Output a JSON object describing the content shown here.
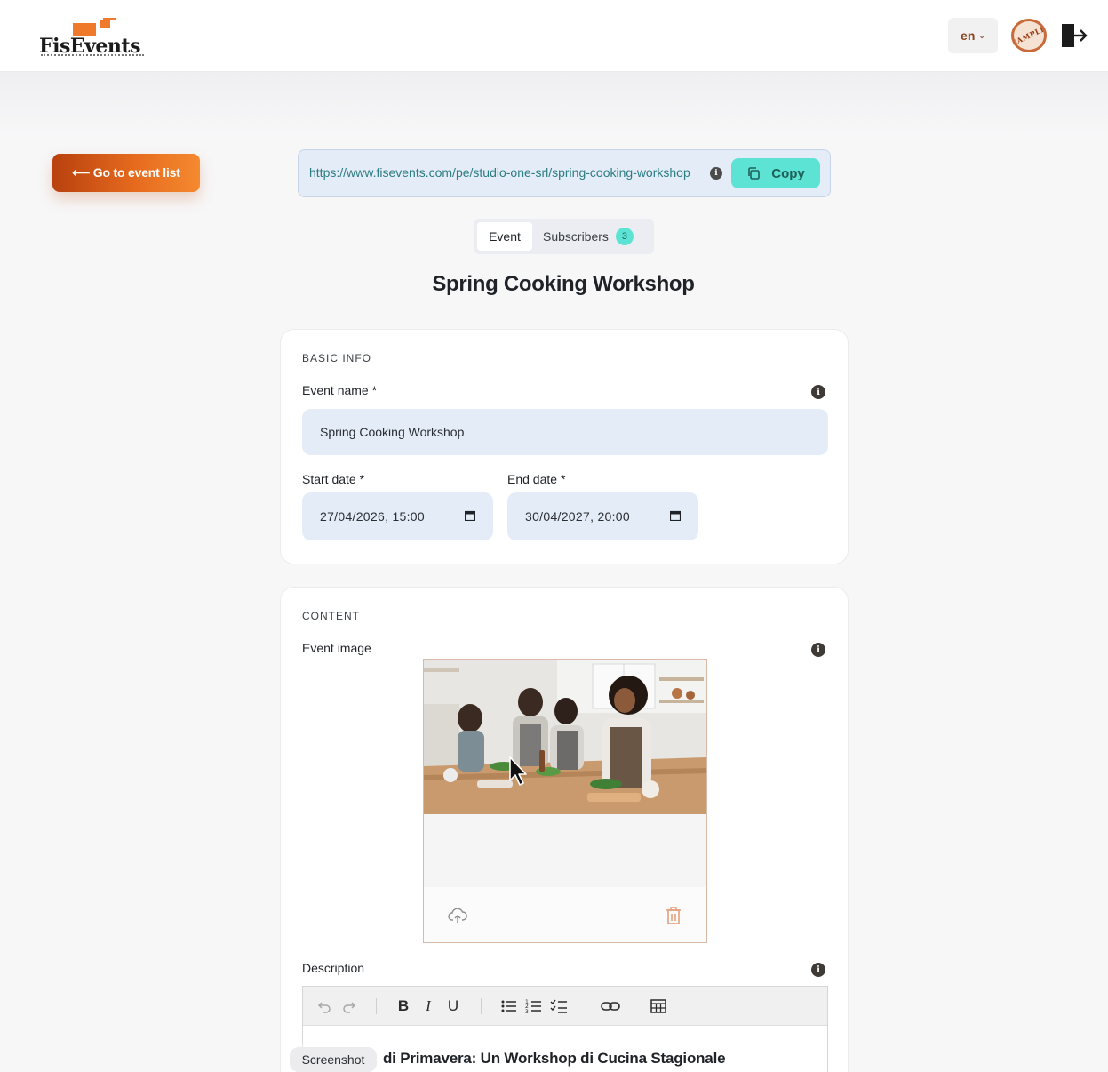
{
  "header": {
    "logo_text": "FisEvents",
    "language": "en",
    "stamp_text": "SAMPLE"
  },
  "nav": {
    "back_label": "⟵ Go to event list"
  },
  "share": {
    "url": "https://www.fisevents.com/pe/studio-one-srl/spring-cooking-workshop",
    "copy_label": "Copy"
  },
  "tabs": {
    "event": "Event",
    "subscribers": "Subscribers",
    "subscribers_count": "3"
  },
  "page": {
    "title": "Spring Cooking Workshop"
  },
  "basic_info": {
    "section_title": "BASIC INFO",
    "event_name_label": "Event name *",
    "event_name_value": "Spring Cooking Workshop",
    "start_label": "Start date *",
    "start_value": "27/04/2026, 15:00",
    "end_label": "End date *",
    "end_value": "30/04/2027, 20:00"
  },
  "content": {
    "section_title": "CONTENT",
    "image_label": "Event image",
    "description_label": "Description",
    "toolbar": {
      "bold": "B",
      "italic": "I",
      "underline": "U"
    },
    "description_heading": "di Primavera: Un Workshop di Cucina Stagionale"
  },
  "tooltip": {
    "label": "Screenshot"
  },
  "colors": {
    "accent": "#e56a1e",
    "teal": "#5ce3d3",
    "input_bg": "#e4ecf7"
  }
}
